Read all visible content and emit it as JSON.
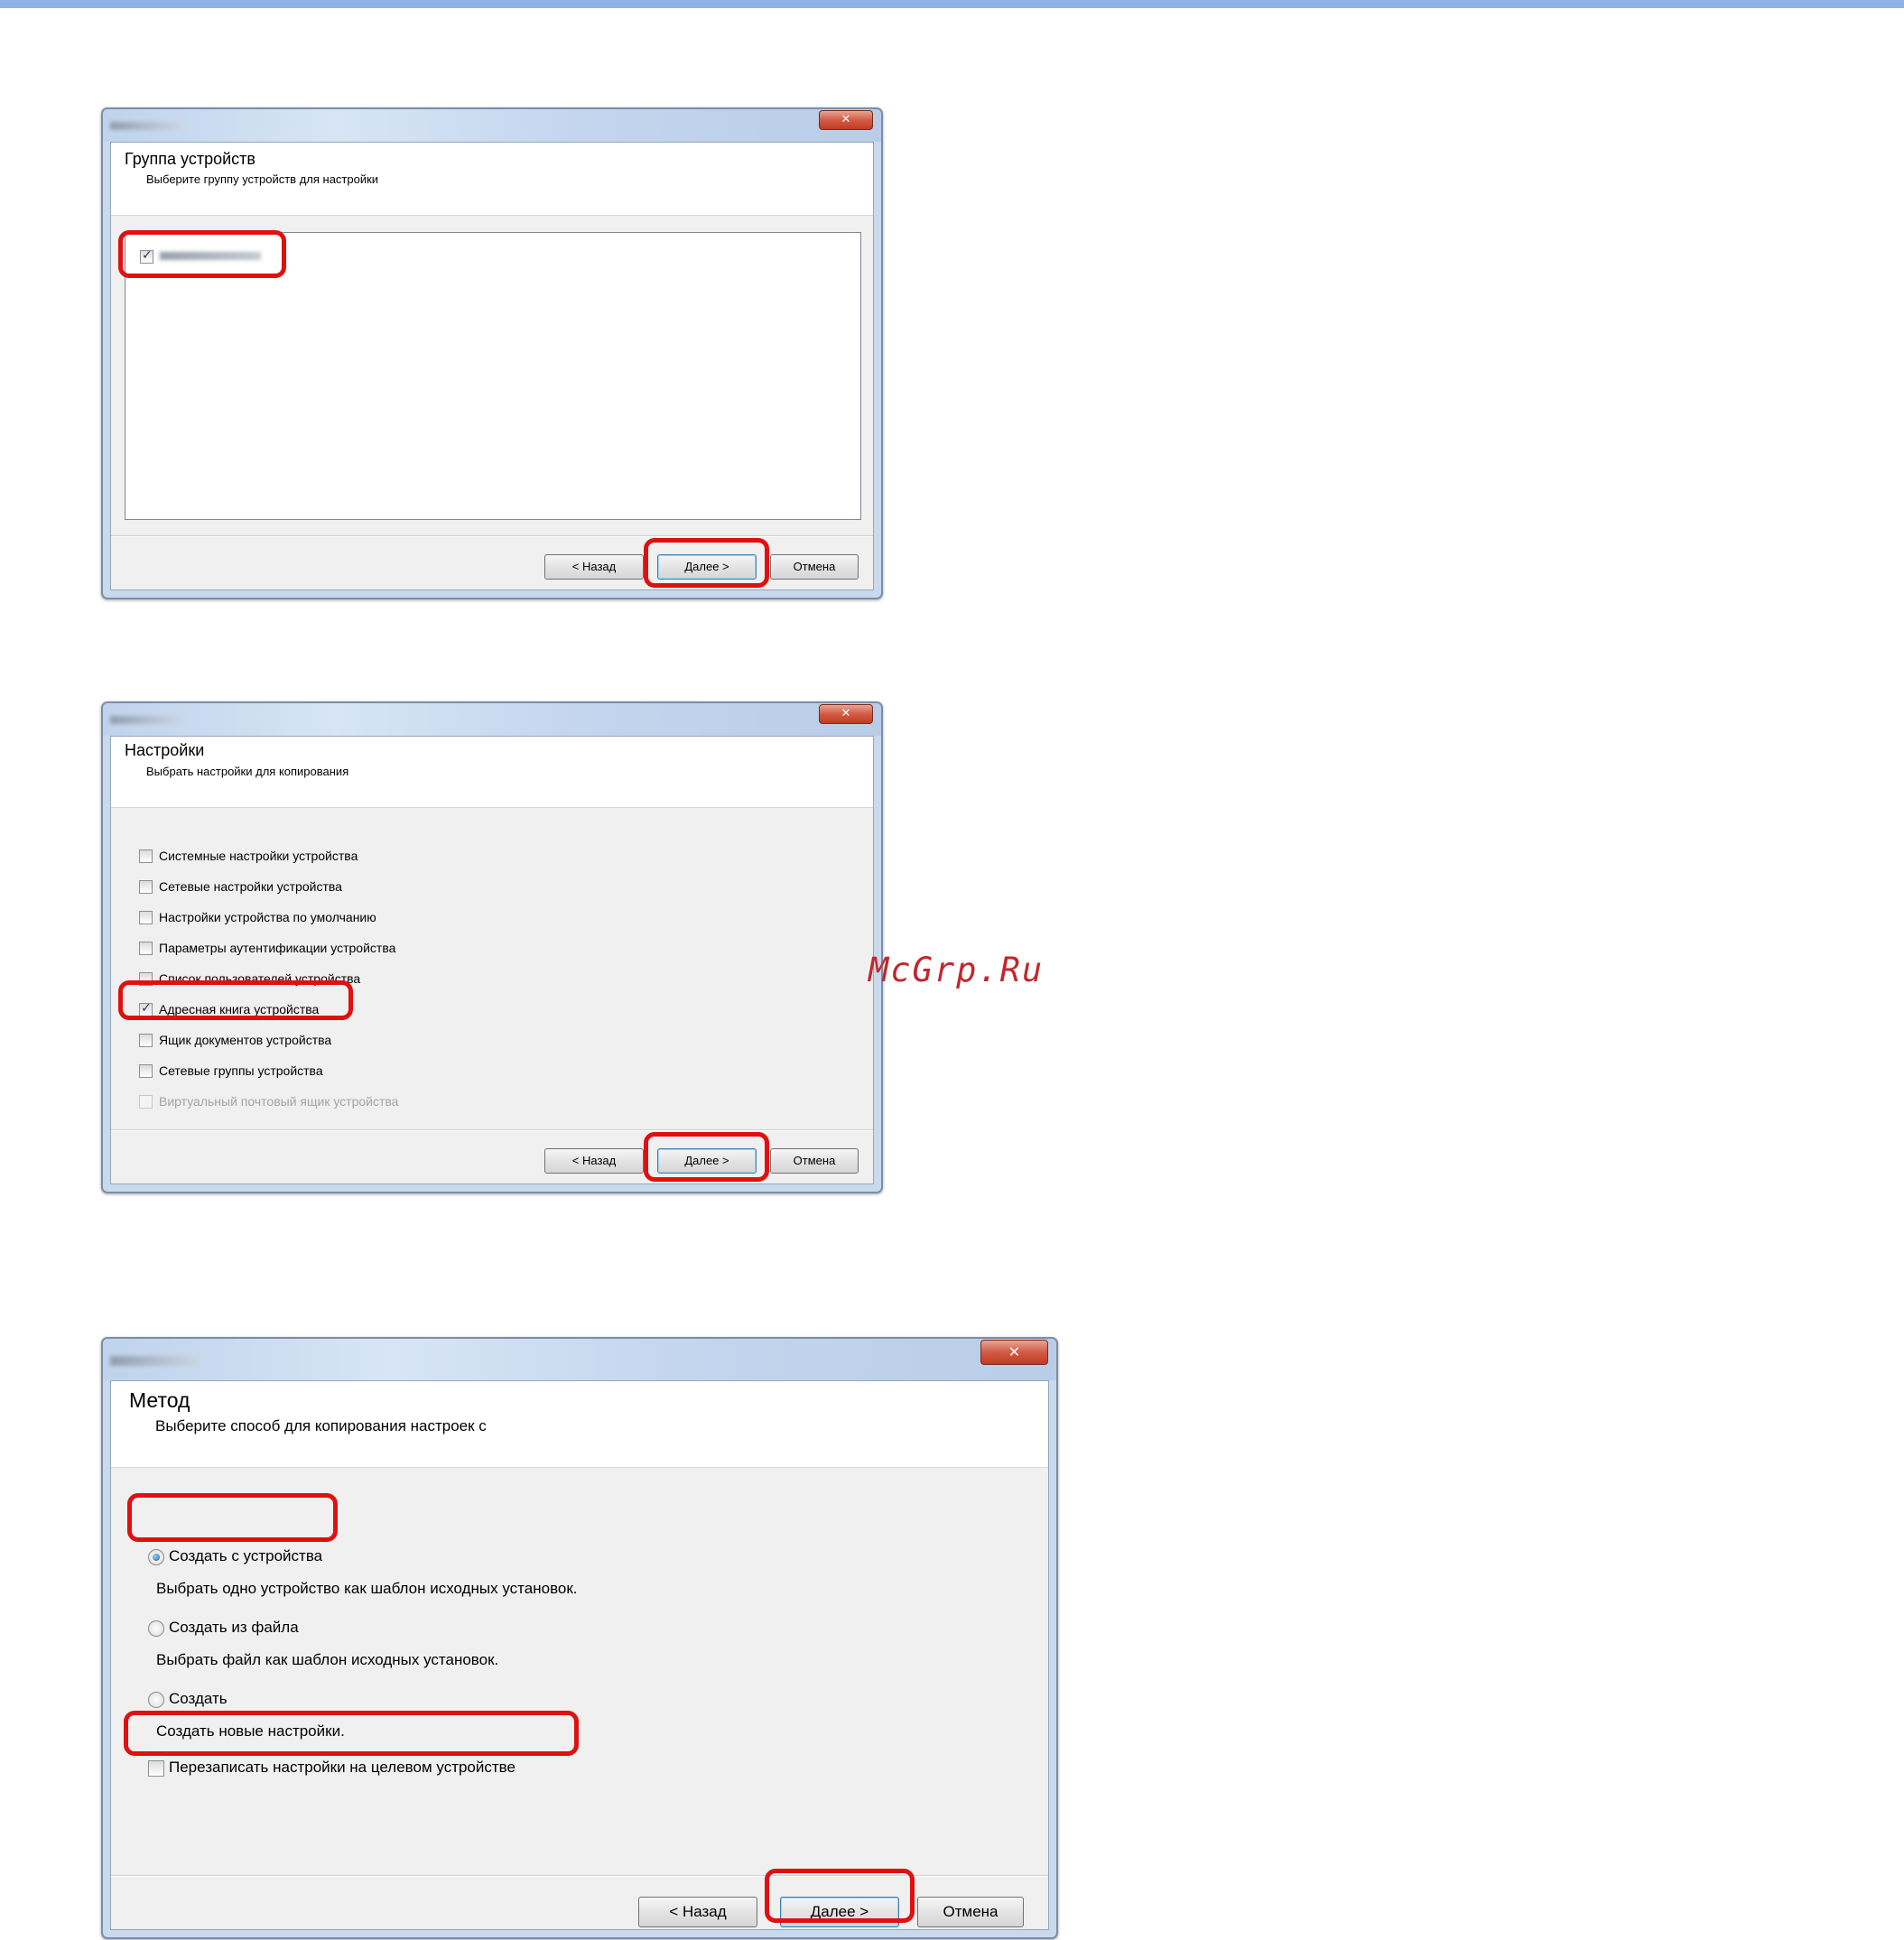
{
  "dialog1": {
    "title": "Группа устройств",
    "subtitle": "Выберите группу устройств для настройки",
    "close_glyph": "✕",
    "back": "< Назад",
    "next": "Далее >",
    "cancel": "Отмена"
  },
  "dialog2": {
    "title": "Настройки",
    "subtitle": "Выбрать настройки для копирования",
    "close_glyph": "✕",
    "options": [
      {
        "label": "Системные настройки устройства",
        "checked": false,
        "enabled": true
      },
      {
        "label": "Сетевые настройки устройства",
        "checked": false,
        "enabled": true
      },
      {
        "label": "Настройки устройства по умолчанию",
        "checked": false,
        "enabled": true
      },
      {
        "label": "Параметры аутентификации устройства",
        "checked": false,
        "enabled": true
      },
      {
        "label": "Список пользователей устройства",
        "checked": false,
        "enabled": true
      },
      {
        "label": "Адресная книга устройства",
        "checked": true,
        "enabled": true
      },
      {
        "label": "Ящик документов устройства",
        "checked": false,
        "enabled": true
      },
      {
        "label": "Сетевые группы устройства",
        "checked": false,
        "enabled": true
      },
      {
        "label": "Виртуальный почтовый ящик устройства",
        "checked": false,
        "enabled": false
      }
    ],
    "back": "< Назад",
    "next": "Далее >",
    "cancel": "Отмена"
  },
  "dialog3": {
    "title": "Метод",
    "subtitle": "Выберите способ для копирования настроек с",
    "close_glyph": "✕",
    "radio1": "Создать с устройства",
    "radio1_desc": "Выбрать одно устройство как шаблон исходных установок.",
    "radio2": "Создать из файла",
    "radio2_desc": "Выбрать файл как шаблон исходных установок.",
    "radio3": "Создать",
    "radio3_desc": "Создать новые настройки.",
    "overwrite": "Перезаписать настройки на целевом устройстве",
    "back": "< Назад",
    "next": "Далее >",
    "cancel": "Отмена"
  },
  "watermark": "McGrp.Ru",
  "colors": {
    "highlight": "#e01010",
    "accent_bar": "#8fb2e8",
    "watermark": "#c0282d"
  }
}
